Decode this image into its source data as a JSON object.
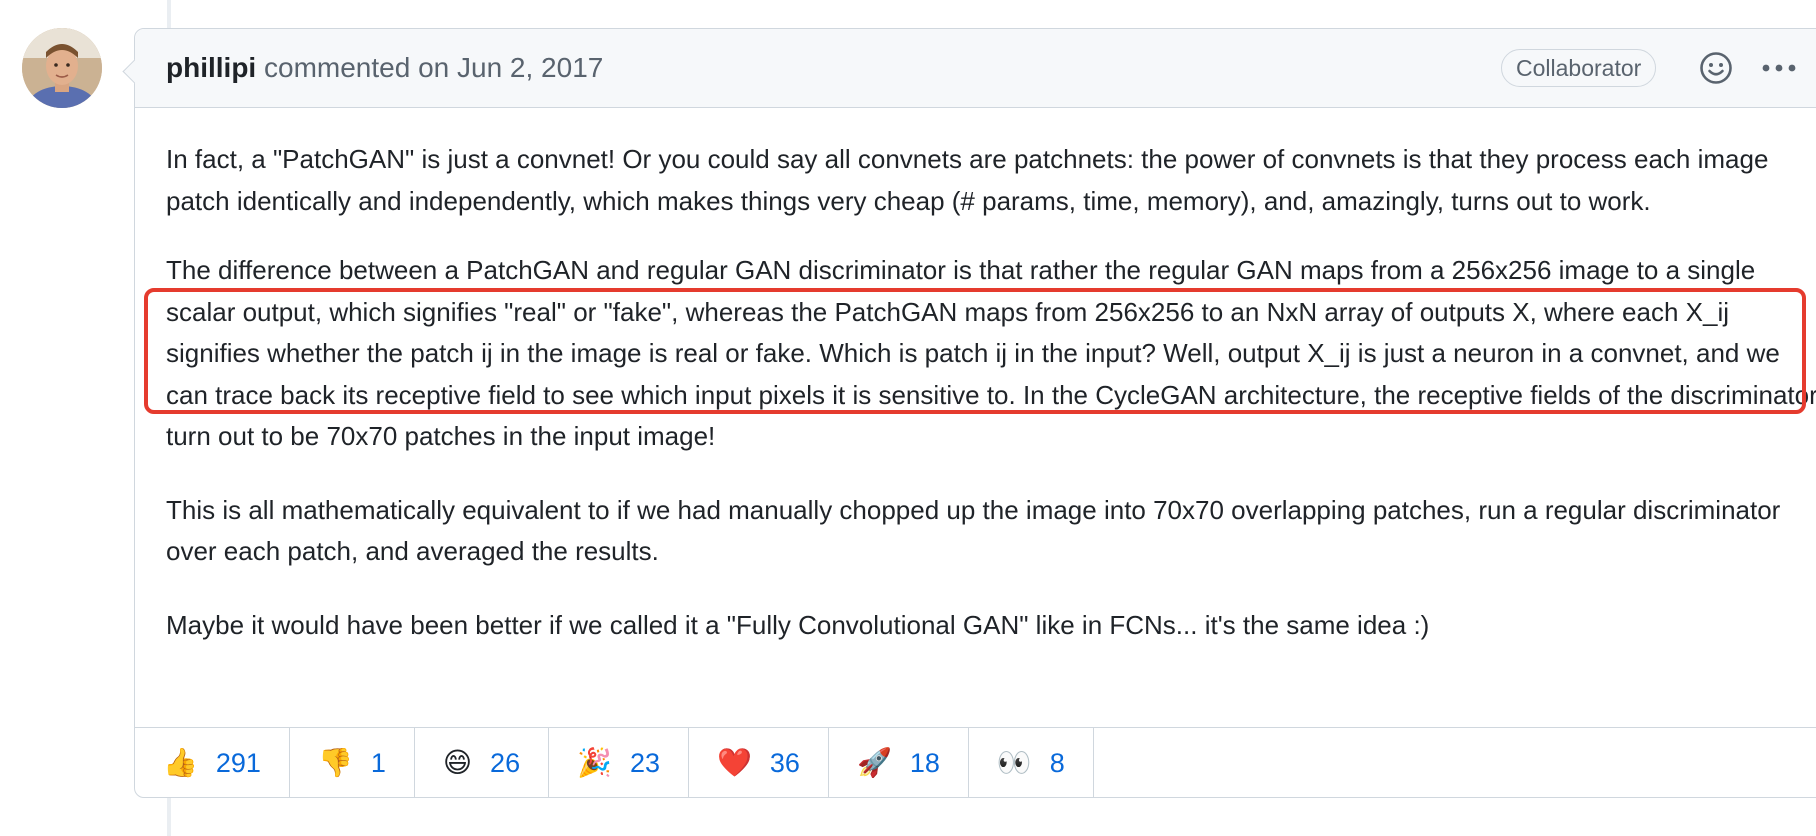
{
  "comment": {
    "author": "phillipi",
    "action": "commented on",
    "date": "Jun 2, 2017",
    "role_badge": "Collaborator",
    "paragraphs": [
      "In fact, a \"PatchGAN\" is just a convnet! Or you could say all convnets are patchnets: the power of convnets is that they process each image patch identically and independently, which makes things very cheap (# params, time, memory), and, amazingly, turns out to work.",
      "The difference between a PatchGAN and regular GAN discriminator is that rather the regular GAN maps from a 256x256 image to a single scalar output, which signifies \"real\" or \"fake\", whereas the PatchGAN maps from 256x256 to an NxN array of outputs X, where each X_ij signifies whether the patch ij in the image is real or fake. Which is patch ij in the input? Well, output X_ij is just a neuron in a convnet, and we can trace back its receptive field to see which input pixels it is sensitive to. In the CycleGAN architecture, the receptive fields of the discriminator turn out to be 70x70 patches in the input image!",
      "This is all mathematically equivalent to if we had manually chopped up the image into 70x70 overlapping patches, run a regular discriminator over each patch, and averaged the results.",
      "Maybe it would have been better if we called it a \"Fully Convolutional GAN\" like in FCNs... it's the same idea :)"
    ]
  },
  "reactions": [
    {
      "icon": "thumbs-up",
      "emoji": "👍",
      "count": "291"
    },
    {
      "icon": "thumbs-down",
      "emoji": "👎",
      "count": "1"
    },
    {
      "icon": "laugh",
      "emoji": "😄",
      "count": "26"
    },
    {
      "icon": "hooray",
      "emoji": "🎉",
      "count": "23"
    },
    {
      "icon": "heart",
      "emoji": "❤️",
      "count": "36"
    },
    {
      "icon": "rocket",
      "emoji": "🚀",
      "count": "18"
    },
    {
      "icon": "eyes",
      "emoji": "👀",
      "count": "8"
    }
  ],
  "colors": {
    "link": "#0969da",
    "highlight": "#e53b2e",
    "border": "#d0d7de",
    "header_bg": "#f6f8fa"
  }
}
